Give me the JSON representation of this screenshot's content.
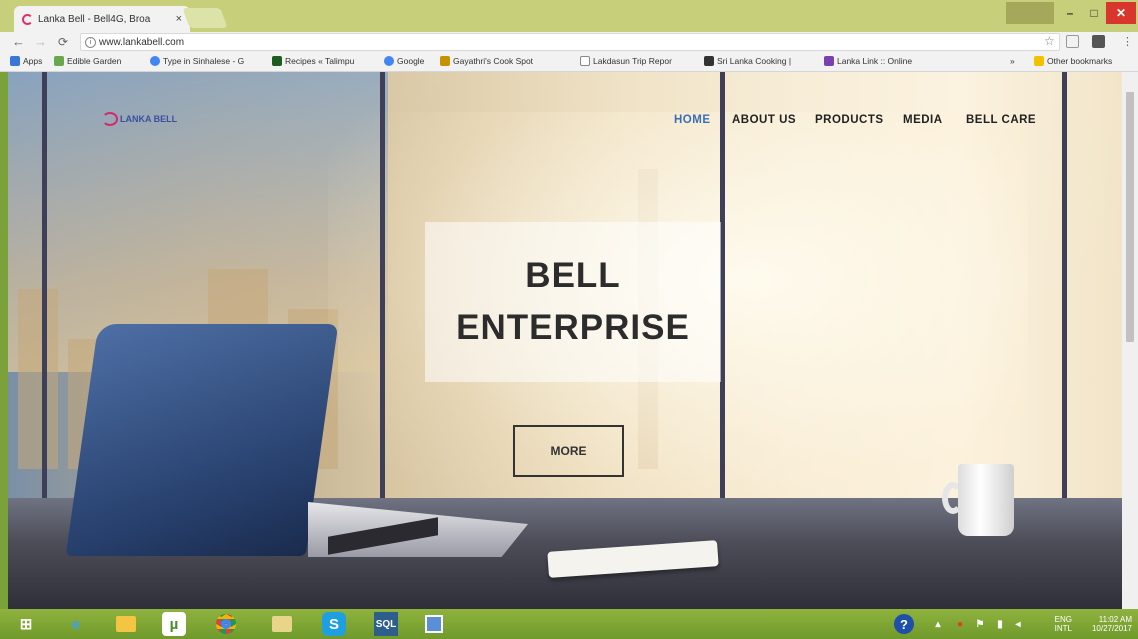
{
  "browser": {
    "tab_title": "Lanka Bell - Bell4G, Broa",
    "tab_close": "×",
    "user_badge": "",
    "min_label": "–",
    "max_label": "□",
    "close_label": "✕",
    "url": "www.lankabell.com",
    "star": "☆"
  },
  "bookmarks": [
    {
      "label": "Apps",
      "color": "#3a75d8"
    },
    {
      "label": "Edible Garden",
      "color": "#6aa84f"
    },
    {
      "label": "Type in Sinhalese - G",
      "color": "#4285f4"
    },
    {
      "label": "Recipes « Talimpu",
      "color": "#1b5e20"
    },
    {
      "label": "Google",
      "color": "#4285f4"
    },
    {
      "label": "Gayathri's Cook Spot",
      "color": "#c69200"
    },
    {
      "label": "Lakdasun Trip Repor",
      "color": "#888888"
    },
    {
      "label": "Sri Lanka Cooking | ",
      "color": "#333333"
    },
    {
      "label": "Lanka Link :: Online",
      "color": "#7a3fb0"
    },
    {
      "label": "»",
      "color": "transparent"
    },
    {
      "label": "Other bookmarks",
      "color": "#f2c200"
    }
  ],
  "site": {
    "logo_text": "LANKA BELL",
    "nav": [
      "HOME",
      "ABOUT US",
      "PRODUCTS",
      "MEDIA",
      "BELL CARE"
    ],
    "hero_line1": "BELL",
    "hero_line2": "ENTERPRISE",
    "more_label": "MORE"
  },
  "taskbar": {
    "apps": [
      "start-icon",
      "ie-icon",
      "file-explorer-icon",
      "utorrent-icon",
      "chrome-icon",
      "library-icon",
      "skype-icon",
      "sql-icon",
      "notepad-icon"
    ],
    "lang": "ENG",
    "layout": "INTL",
    "time": "11:02 AM",
    "date": "10/27/2017"
  },
  "colors": {
    "accent": "#3a6fb8",
    "taskbar": "#7ba23a",
    "close": "#d8362c"
  }
}
